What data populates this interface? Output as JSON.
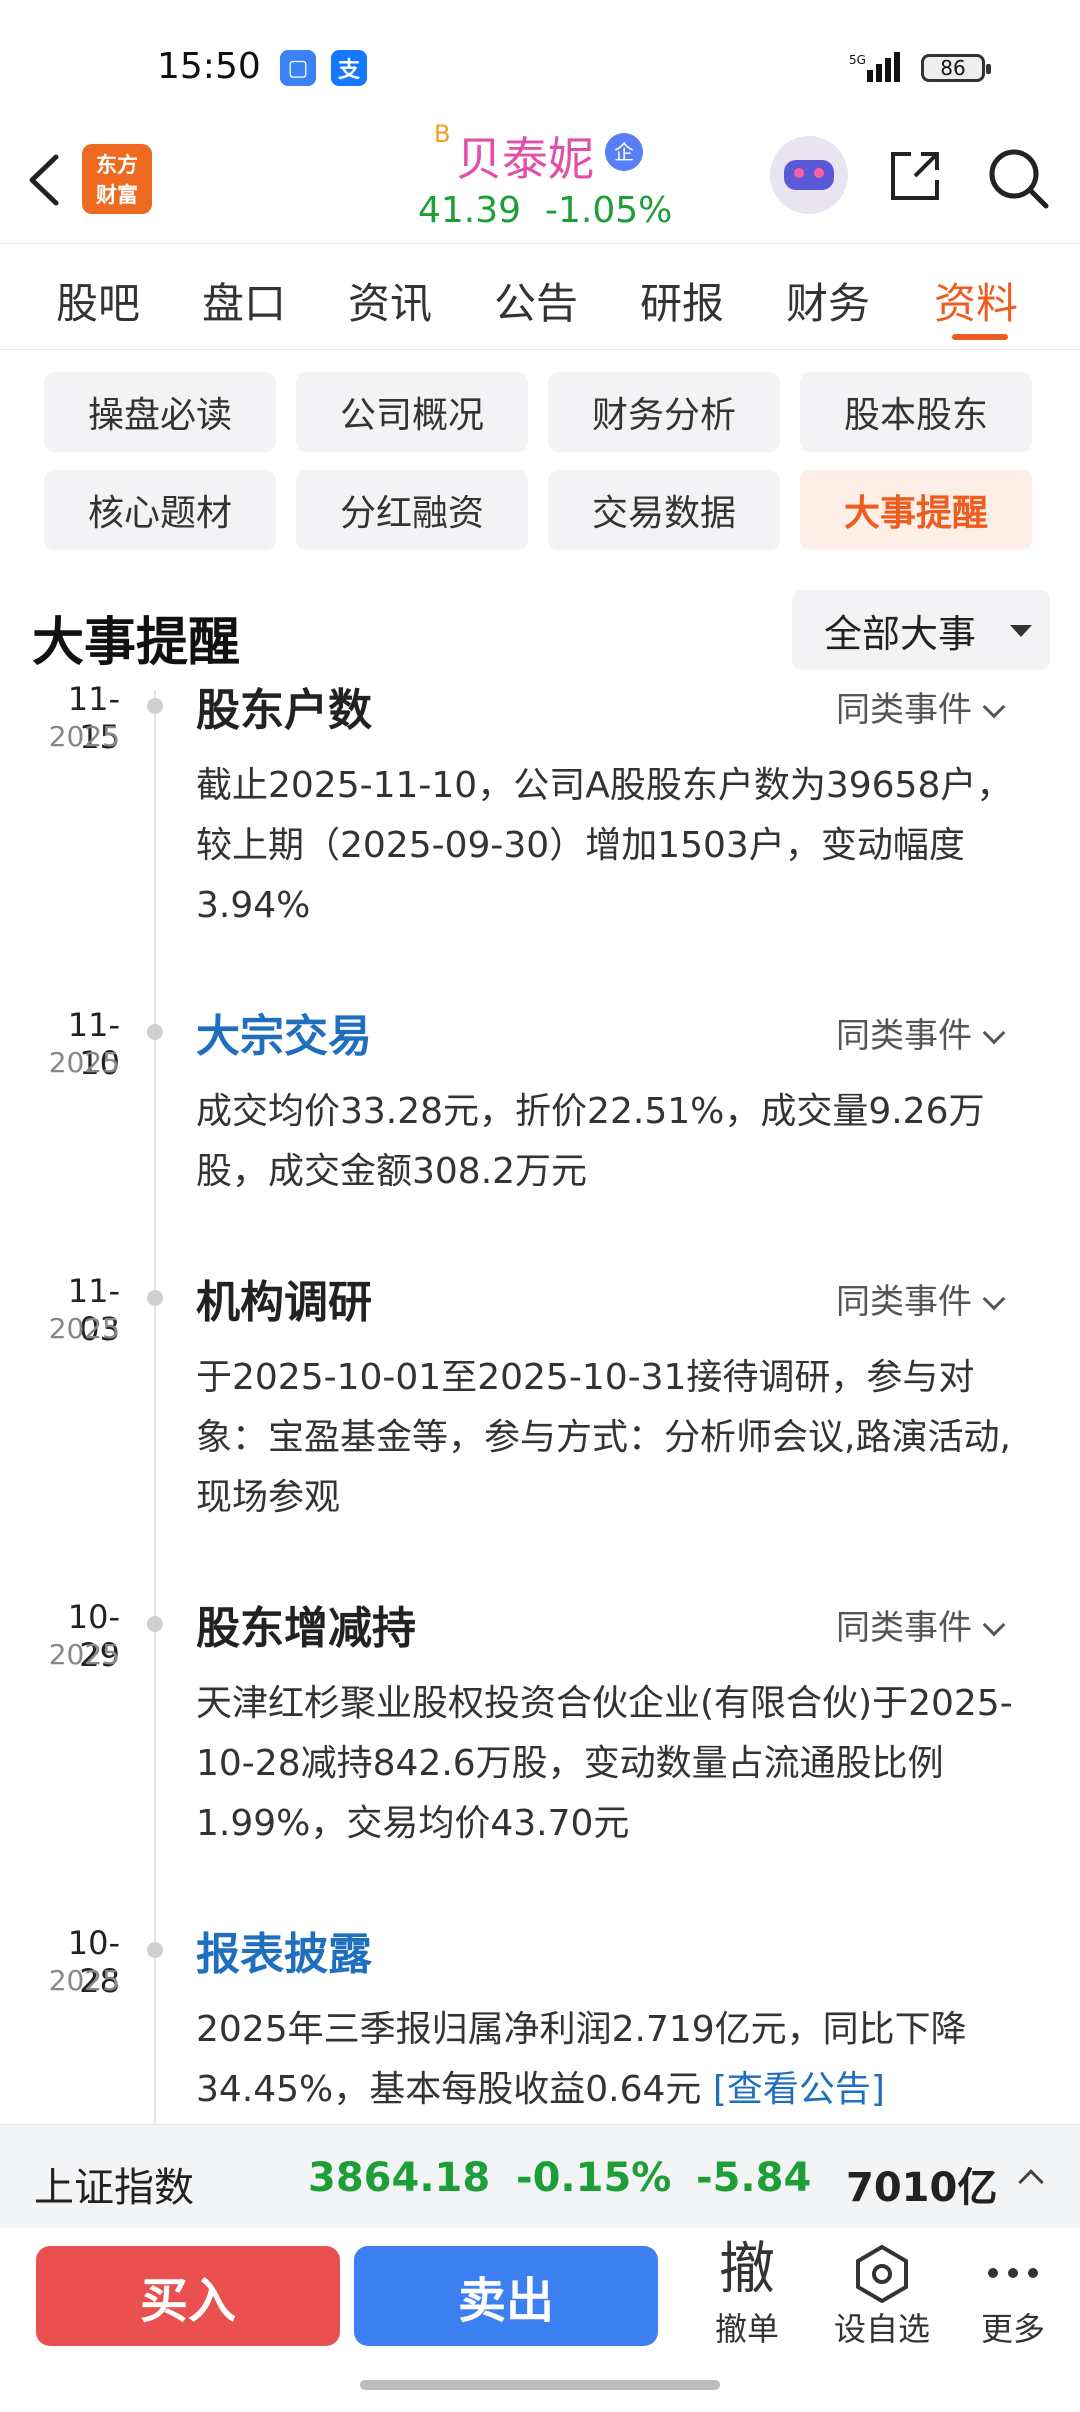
{
  "status_bar": {
    "time": "15:50",
    "battery": "86",
    "network": "5G",
    "app_badge_1": "▢",
    "app_badge_2": "支"
  },
  "header": {
    "logo_line1": "东方",
    "logo_line2": "财富",
    "stock_prefix": "B",
    "stock_name": "贝泰妮",
    "qi_badge": "企",
    "price": "41.39",
    "change": "-1.05%"
  },
  "tabs": [
    "股吧",
    "盘口",
    "资讯",
    "公告",
    "研报",
    "财务",
    "资料"
  ],
  "active_tab": "资料",
  "sub_buttons": [
    "操盘必读",
    "公司概况",
    "财务分析",
    "股本股东",
    "核心题材",
    "分红融资",
    "交易数据",
    "大事提醒"
  ],
  "active_sub": "大事提醒",
  "section": {
    "title": "大事提醒",
    "filter": "全部大事"
  },
  "events": [
    {
      "date": "11-15",
      "year": "2025",
      "title": "股东户数",
      "title_link": false,
      "similar": "同类事件",
      "desc": "截止2025-11-10，公司A股股东户数为39658户，较上期（2025-09-30）增加1503户，变动幅度3.94%"
    },
    {
      "date": "11-10",
      "year": "2025",
      "title": "大宗交易",
      "title_link": true,
      "similar": "同类事件",
      "desc": "成交均价33.28元，折价22.51%，成交量9.26万股，成交金额308.2万元"
    },
    {
      "date": "11-03",
      "year": "2025",
      "title": "机构调研",
      "title_link": false,
      "similar": "同类事件",
      "desc": "于2025-10-01至2025-10-31接待调研，参与对象：宝盈基金等，参与方式：分析师会议,路演活动,现场参观"
    },
    {
      "date": "10-29",
      "year": "2025",
      "title": "股东增减持",
      "title_link": false,
      "similar": "同类事件",
      "desc": "天津红杉聚业股权投资合伙企业(有限合伙)于2025-10-28减持842.6万股，变动数量占流通股比例1.99%，交易均价43.70元"
    },
    {
      "date": "10-28",
      "year": "2025",
      "title": "报表披露",
      "title_link": true,
      "similar": "",
      "desc": "2025年三季报归属净利润2.719亿元，同比下降34.45%，基本每股收益0.64元",
      "link_text": "[查看公告]"
    }
  ],
  "index_bar": {
    "name": "上证指数",
    "value": "3864.18",
    "pct": "-0.15%",
    "change": "-5.84",
    "volume": "7010亿"
  },
  "bottom_bar": {
    "buy": "买入",
    "sell": "卖出",
    "cancel_icon_char": "撤",
    "cancel_label": "撤单",
    "watchlist_label": "设自选",
    "more_label": "更多"
  },
  "colors": {
    "accent": "#ee5d1f",
    "down_green": "#1e9e36",
    "link_blue": "#1f6fbe",
    "buy_red": "#e9504f",
    "sell_blue": "#3b7ff0"
  }
}
